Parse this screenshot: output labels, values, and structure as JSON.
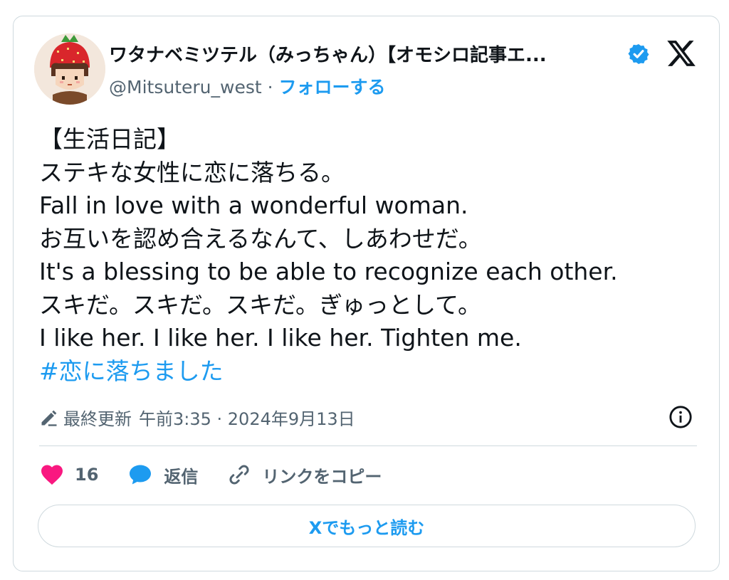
{
  "tweet": {
    "author": {
      "display_name": "ワタナベミツテル（みっちゃん）【オモシロ記事エ...",
      "handle": "@Mitsuteru_west",
      "separator": " · ",
      "follow_label": "フォローする"
    },
    "lines": [
      "【生活日記】",
      "ステキな女性に恋に落ちる。",
      "Fall in love with a wonderful woman.",
      "お互いを認め合えるなんて、しあわせだ。",
      "It's a blessing to be able to recognize each other.",
      "スキだ。スキだ。スキだ。ぎゅっとして。",
      "I like her. I like her. I like her. Tighten me."
    ],
    "hashtag": "#恋に落ちました",
    "meta": {
      "edited_label": "最終更新",
      "timestamp": "午前3:35 · 2024年9月13日"
    },
    "actions": {
      "like_count": "16",
      "reply_label": "返信",
      "copy_link_label": "リンクをコピー"
    },
    "read_more_label": "Xでもっと読む"
  },
  "colors": {
    "accent": "#1d9bf0",
    "like": "#f91880",
    "muted": "#536471",
    "border": "#cfd9de"
  },
  "icons": [
    "avatar-image",
    "verified-badge-icon",
    "x-logo-icon",
    "edit-pencil-icon",
    "info-icon",
    "heart-icon",
    "reply-bubble-icon",
    "link-icon"
  ]
}
